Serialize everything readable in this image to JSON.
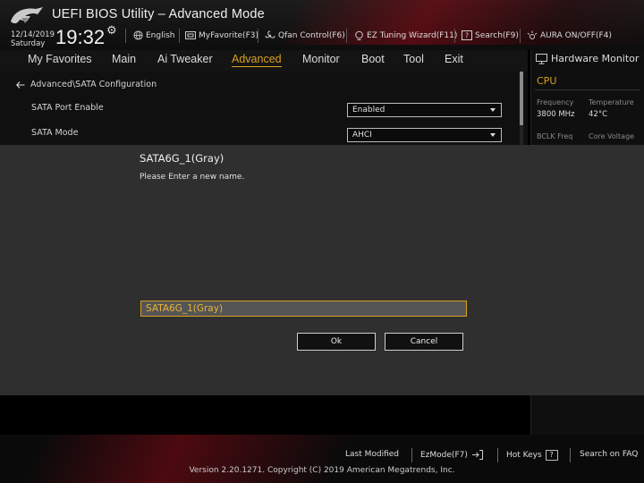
{
  "header": {
    "title": "UEFI BIOS Utility – Advanced Mode",
    "date": "12/14/2019",
    "weekday": "Saturday",
    "time": "19:32",
    "language": "English",
    "my_favorite": "MyFavorite(F3)",
    "qfan": "Qfan Control(F6)",
    "ez_tuning": "EZ Tuning Wizard(F11)",
    "search": "Search(F9)",
    "aura": "AURA ON/OFF(F4)"
  },
  "nav": {
    "tabs": [
      {
        "label": "My Favorites"
      },
      {
        "label": "Main"
      },
      {
        "label": "Ai Tweaker"
      },
      {
        "label": "Advanced"
      },
      {
        "label": "Monitor"
      },
      {
        "label": "Boot"
      },
      {
        "label": "Tool"
      },
      {
        "label": "Exit"
      }
    ],
    "active": "Advanced"
  },
  "main": {
    "breadcrumb": "Advanced\\SATA Configuration",
    "rows": [
      {
        "label": "SATA Port Enable",
        "value": "Enabled"
      },
      {
        "label": "SATA Mode",
        "value": "AHCI"
      }
    ]
  },
  "hwmon": {
    "title": "Hardware Monitor",
    "section": "CPU",
    "frequency_label": "Frequency",
    "frequency_value": "3800 MHz",
    "temperature_label": "Temperature",
    "temperature_value": "42°C",
    "bclk_label": "BCLK Freq",
    "voltage_label": "Core Voltage"
  },
  "dialog": {
    "title": "SATA6G_1(Gray)",
    "message": "Please Enter a new name.",
    "input_value": "SATA6G_1(Gray)",
    "ok_label": "Ok",
    "cancel_label": "Cancel"
  },
  "footer": {
    "last_modified": "Last Modified",
    "ezmode": "EzMode(F7)",
    "hotkeys": "Hot Keys",
    "hotkeys_key": "?",
    "search_faq": "Search on FAQ",
    "version": "Version 2.20.1271. Copyright (C) 2019 American Megatrends, Inc."
  },
  "colors": {
    "accent": "#d8a020",
    "brand_red": "#8c0a14",
    "dialog_bg": "#2f2f2f"
  }
}
